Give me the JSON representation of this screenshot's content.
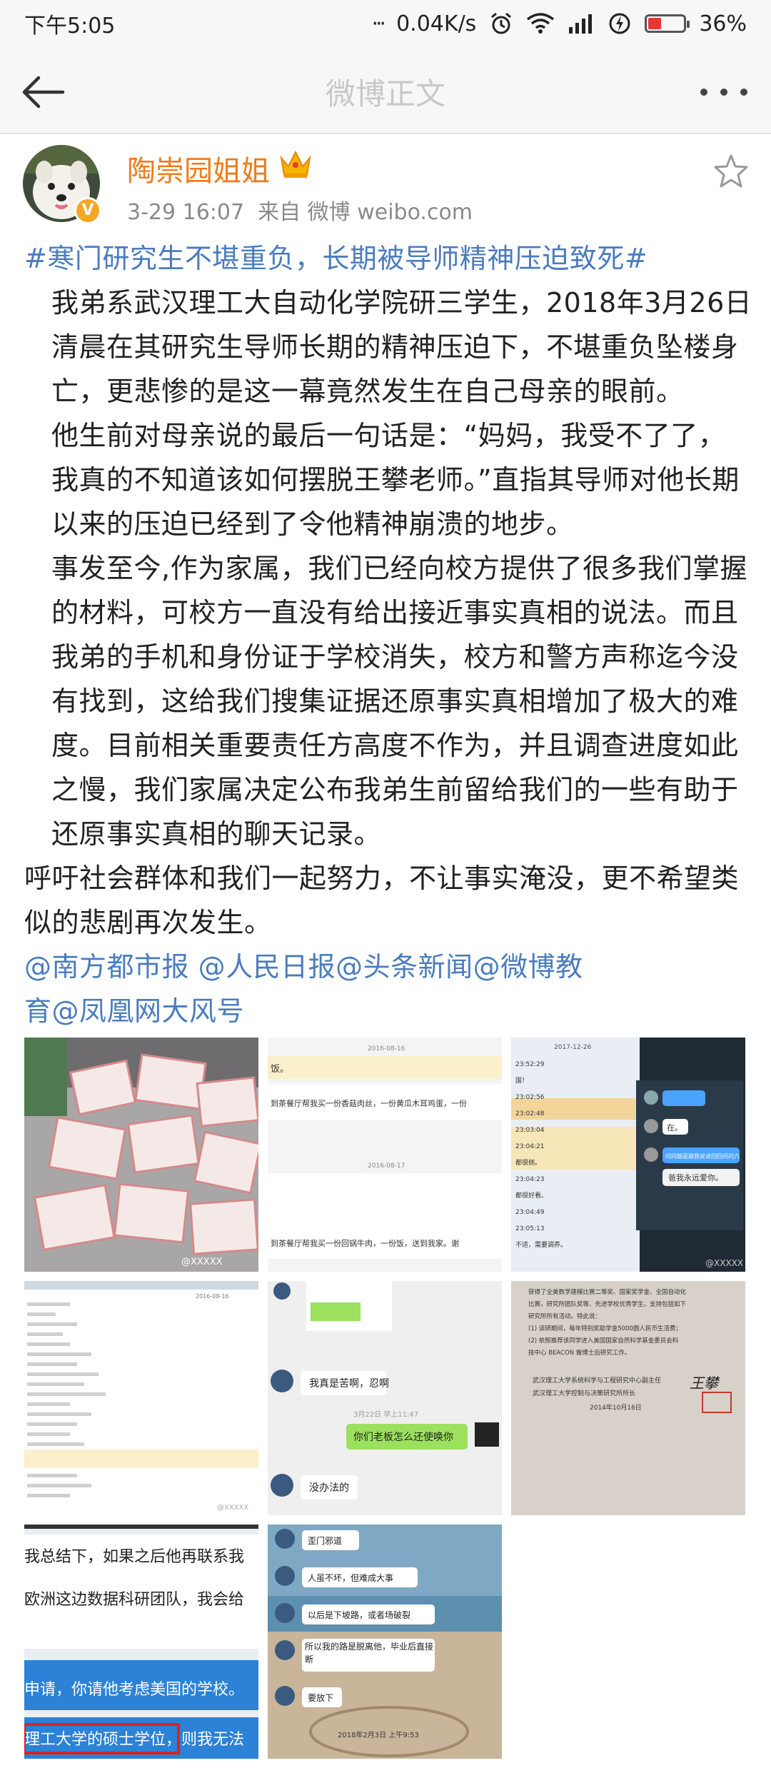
{
  "status_bar": {
    "time": "下午5:05",
    "dots": "···",
    "network_speed": "0.04K/s",
    "battery_percent": "36%",
    "battery_level": 0.36,
    "icons": [
      "alarm-icon",
      "wifi-icon",
      "signal-icon",
      "charging-icon",
      "battery-icon"
    ]
  },
  "nav": {
    "title": "微博正文",
    "back_icon": "back-arrow-icon",
    "more_icon": "more-dots-icon"
  },
  "post": {
    "author": "陶崇园姐姐",
    "meta": "3-29 16:07  来自 微博 weibo.com",
    "verified_badge": "V",
    "hashtag": "#寒门研究生不堪重负，长期被导师精神压迫致死#",
    "paragraphs": [
      "我弟系武汉理工大自动化学院研三学生，2018年3月26日清晨在其研究生导师长期的精神压迫下，不堪重负坠楼身亡，更悲惨的是这一幕竟然发生在自己母亲的眼前。",
      "他生前对母亲说的最后一句话是：“妈妈，我受不了了，我真的不知道该如何摆脱王攀老师。”直指其导师对他长期以来的压迫已经到了令他精神崩溃的地步。",
      "事发至今,作为家属，我们已经向校方提供了很多我们掌握的材料，可校方一直没有给出接近事实真相的说法。而且我弟的手机和身份证于学校消失，校方和警方声称迄今没有找到，这给我们搜集证据还原事实真相增加了极大的难度。目前相关重要责任方高度不作为，并且调查进度如此之慢，我们家属决定公布我弟生前留给我们的一些有助于还原事实真相的聊天记录。",
      "呼吁社会群体和我们一起努力，不让事实淹没，更不希望类似的悲剧再次发生。"
    ],
    "mentions_line1": "@南方都市报 @人民日报@头条新闻@微博教",
    "mentions_line2": "育@凤凰网大风号"
  },
  "images": {
    "img2": {
      "date1": "2016-08-16",
      "msg1a": "饭。",
      "msg1b": "到茶餐厅帮我买一份香菇肉丝，一份黄瓜木耳鸡蛋，一份",
      "date2": "2016-08-17",
      "msg2": "到茶餐厅帮我买一份回锅牛肉，一份饭，送到我家。谢"
    },
    "img3": {
      "date": "2017-12-26",
      "lines": [
        "23:52:29",
        "国！",
        "23:02:56",
        "23:02:48",
        "23:03:04",
        "23:04:21",
        "都很侧。",
        "23:04:23",
        "都很好看。",
        "23:04:49",
        "23:05:13",
        "不适，需要调养。"
      ],
      "bubbles": [
        "在。",
        "问问题是跟我说说回回问问六",
        "爸我永远爱你。"
      ]
    },
    "img4": {
      "date": "2016-08-16"
    },
    "img5": {
      "bubbles": [
        "我真是苦啊，忍啊",
        "你们老板怎么还使唤你",
        "没办法的"
      ],
      "timestamp": "3月22日 早上11:47"
    },
    "img6": {
      "text_lines": [
        "获得了全美数学建模比赛二等奖、国家奖学金、全国自动化",
        "比赛，研究所团队奖等、先进学校优秀学生。支持包括如下",
        "研究所所有活动。特此说：",
        "(1) 读研期间，每年特别奖助学金5000圆人民币生活费；",
        "(2) 依照推荐该同学进入美国国家自然科学基金委员会科",
        "技中心 BEACON 做博士后研究工作。"
      ],
      "signature": "王攀",
      "org1": "武汉理工大学系统科学与工程研究中心副主任",
      "org2": "武汉理工大学控制与决策研究所所长",
      "date": "2014年10月16日"
    },
    "img7": {
      "lines": [
        "我总结下，如果之后他再联系我",
        "欧洲这边数据科研团队，我会给",
        "申请，你请他考虑美国的学校。",
        "理工大学的硕士学位，则我无法"
      ],
      "highlighted": "理工大学的硕士学位"
    },
    "img8": {
      "bubbles": [
        "歪门邪道",
        "人虽不坏，但难成大事",
        "以后是下坡路，或者场破裂",
        "所以我的路是脱离他，毕业后直接断",
        "要放下"
      ],
      "timestamp": "2018年2月3日 上午9:53"
    },
    "watermark": "@XXXXX"
  }
}
